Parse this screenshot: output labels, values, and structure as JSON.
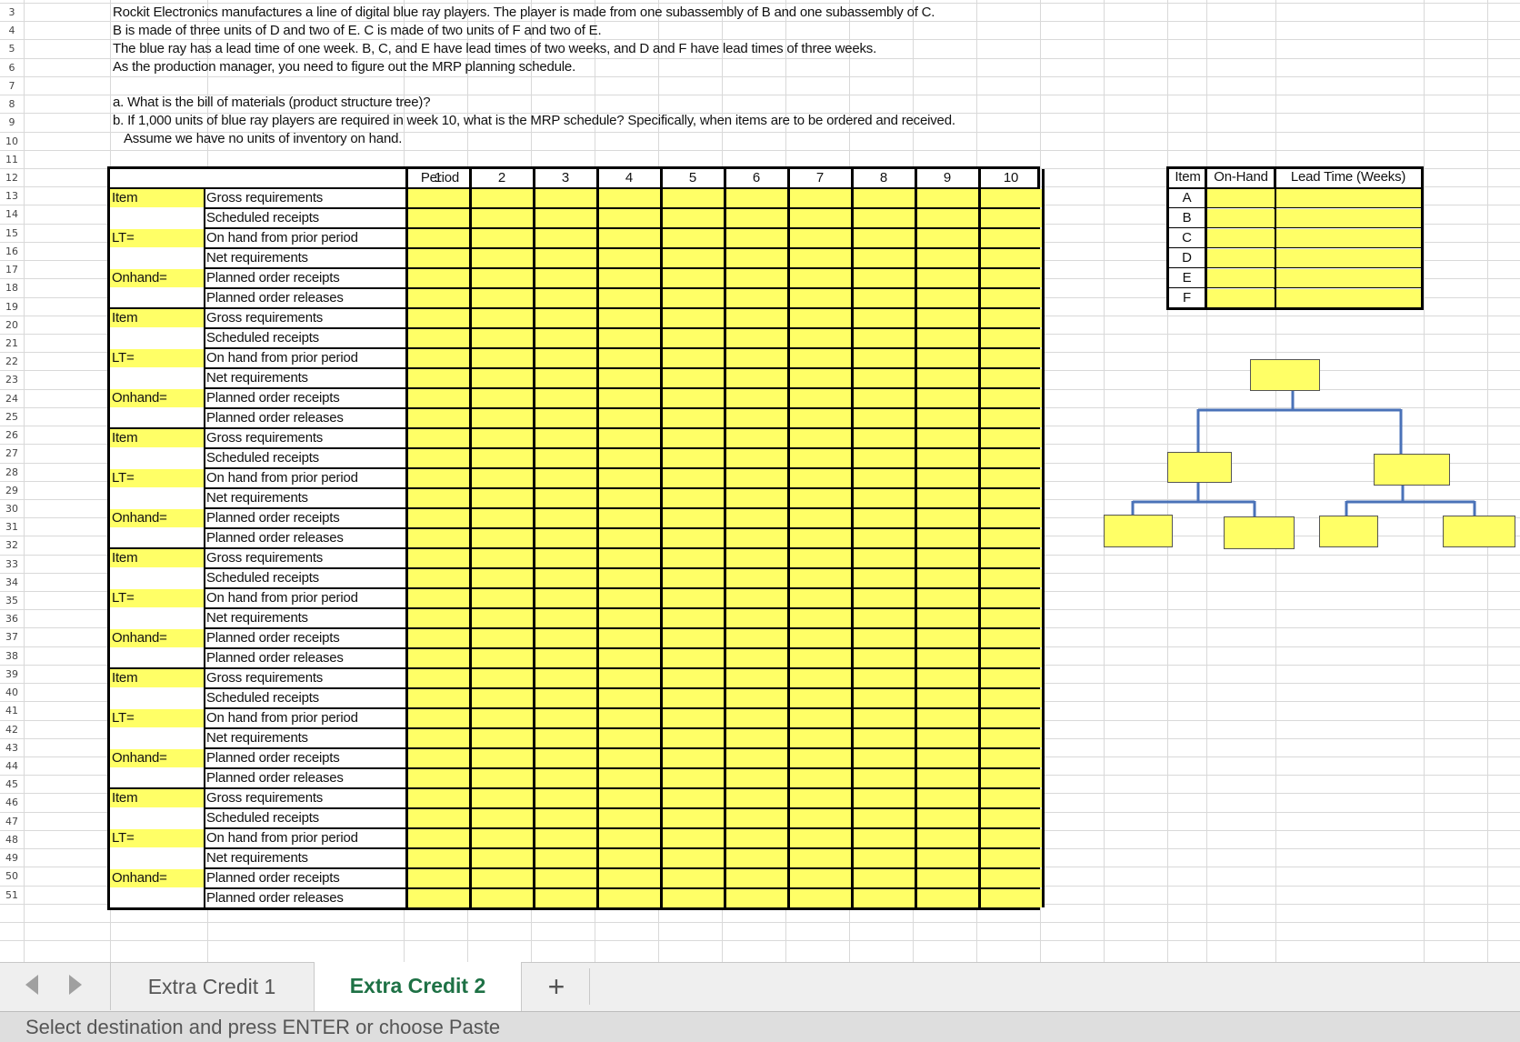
{
  "row_numbers": [
    "3",
    "4",
    "5",
    "6",
    "7",
    "8",
    "9",
    "10",
    "11",
    "12",
    "13",
    "14",
    "15",
    "16",
    "17",
    "18",
    "19",
    "20",
    "21",
    "22",
    "23",
    "24",
    "25",
    "26",
    "27",
    "28",
    "29",
    "30",
    "31",
    "32",
    "33",
    "34",
    "35",
    "36",
    "37",
    "38",
    "39",
    "40",
    "41",
    "42",
    "43",
    "44",
    "45",
    "46",
    "47",
    "48",
    "49",
    "50",
    "51"
  ],
  "problem": {
    "line1": "Rockit Electronics manufactures a line of digital blue ray players. The player is made from one subassembly of B and one subassembly of C.",
    "line2": "B is made of three units of D and two of E. C is made of two units of F and two of E.",
    "line3": "The blue ray has a lead time of one week. B, C, and E have lead times of two weeks, and D and F have lead times of three weeks.",
    "line4": "As the production manager, you need to figure out the MRP planning schedule.",
    "question_a": "a. What is the bill of materials (product structure tree)?",
    "question_b": "b. If 1,000 units of blue ray players are required in week 10, what is the MRP schedule? Specifically, when items are to be ordered and received.",
    "assumption": "Assume we have no units of inventory on hand."
  },
  "mrp_table": {
    "period_label": "Period",
    "periods": [
      "1",
      "2",
      "3",
      "4",
      "5",
      "6",
      "7",
      "8",
      "9",
      "10"
    ],
    "block_labels": {
      "item": "Item",
      "lt": "LT=",
      "onhand": "Onhand="
    },
    "row_labels": [
      "Gross requirements",
      "Scheduled receipts",
      "On hand from prior period",
      "Net requirements",
      "Planned order receipts",
      "Planned order releases"
    ],
    "block_count": 6
  },
  "item_table": {
    "headers": [
      "Item",
      "On-Hand",
      "Lead Time (Weeks)"
    ],
    "items": [
      "A",
      "B",
      "C",
      "D",
      "E",
      "F"
    ]
  },
  "tabs": {
    "tab1": "Extra Credit 1",
    "tab2": "Extra Credit 2",
    "add": "+"
  },
  "status": "Select destination and press ENTER or choose Paste",
  "colors": {
    "highlight": "#ffff66",
    "active_tab": "#1e7145",
    "tree_lines": "#4a72b8"
  }
}
